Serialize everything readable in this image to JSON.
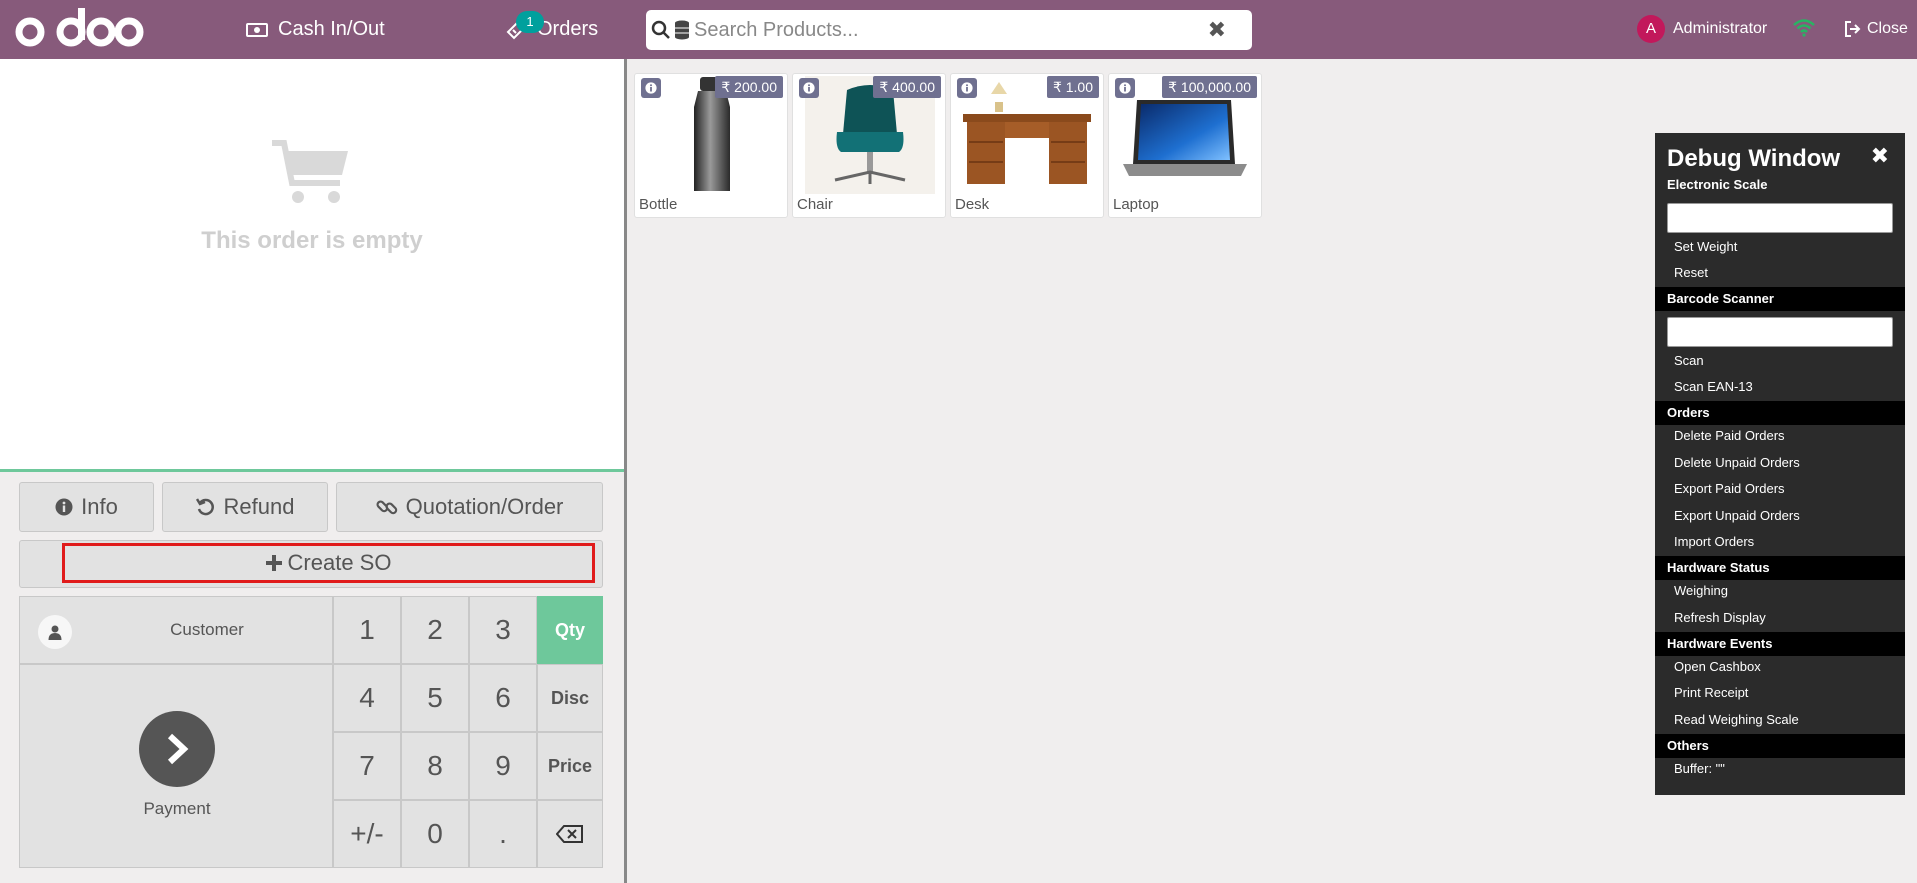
{
  "header": {
    "cash_label": "Cash In/Out",
    "orders_label": "Orders",
    "orders_count": "1",
    "search_placeholder": "Search Products...",
    "user_initial": "A",
    "user_name": "Administrator",
    "close_label": "Close"
  },
  "order": {
    "empty_text": "This order is empty"
  },
  "actions": {
    "info": "Info",
    "refund": "Refund",
    "quotation": "Quotation/Order",
    "create_so": "Create SO"
  },
  "pad": {
    "customer": "Customer",
    "payment": "Payment",
    "keys": [
      "1",
      "2",
      "3",
      "4",
      "5",
      "6",
      "7",
      "8",
      "9",
      "+/-",
      "0",
      "."
    ],
    "modes": [
      "Qty",
      "Disc",
      "Price"
    ],
    "active_mode": "Qty"
  },
  "products": [
    {
      "name": "Bottle",
      "price": "₹ 200.00"
    },
    {
      "name": "Chair",
      "price": "₹ 400.00"
    },
    {
      "name": "Desk",
      "price": "₹ 1.00"
    },
    {
      "name": "Laptop",
      "price": "₹ 100,000.00"
    }
  ],
  "debug": {
    "title": "Debug Window",
    "sections": {
      "scale": "Electronic Scale",
      "barcode": "Barcode Scanner",
      "orders": "Orders",
      "hw_status": "Hardware Status",
      "hw_events": "Hardware Events",
      "others": "Others"
    },
    "items": {
      "set_weight": "Set Weight",
      "reset": "Reset",
      "scan": "Scan",
      "scan_ean": "Scan EAN-13",
      "delete_paid": "Delete Paid Orders",
      "delete_unpaid": "Delete Unpaid Orders",
      "export_paid": "Export Paid Orders",
      "export_unpaid": "Export Unpaid Orders",
      "import": "Import Orders",
      "weighing": "Weighing",
      "refresh": "Refresh Display",
      "open_cashbox": "Open Cashbox",
      "print_receipt": "Print Receipt",
      "read_scale": "Read Weighing Scale",
      "buffer": "Buffer: \"\""
    }
  },
  "colors": {
    "brand": "#875a7b",
    "accent_green": "#6ec89b",
    "badge_teal": "#00a09d",
    "highlight_red": "#e01b1b"
  }
}
